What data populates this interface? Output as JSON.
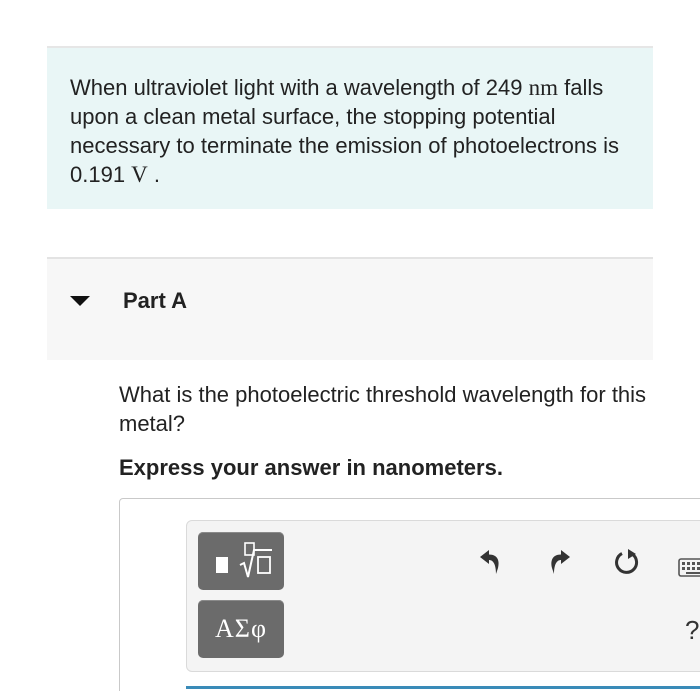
{
  "intro": {
    "line1_pre": "When ultraviolet light with a wavelength of 249 ",
    "unit_nm": "nm",
    "line2_to_value": "falls upon a clean metal surface, the stopping potential necessary to terminate the emission of photoelectrons is 0.191 ",
    "unit_v": "V",
    "end": " ."
  },
  "part": {
    "title": "Part A"
  },
  "question": {
    "text": "What is the photoelectric threshold wavelength for this metal?",
    "instruction": "Express your answer in nanometers."
  },
  "toolbar": {
    "symbols_label": "ΑΣφ",
    "help_label": "?"
  },
  "colors": {
    "intro_bg": "#e9f6f6",
    "part_bg": "#f7f7f7",
    "button_gray": "#6b6b6b",
    "input_accent": "#3a8bb8"
  },
  "icons": [
    "caret-down-icon",
    "templates-icon",
    "undo-icon",
    "redo-icon",
    "reset-icon",
    "keyboard-icon",
    "help-icon"
  ]
}
